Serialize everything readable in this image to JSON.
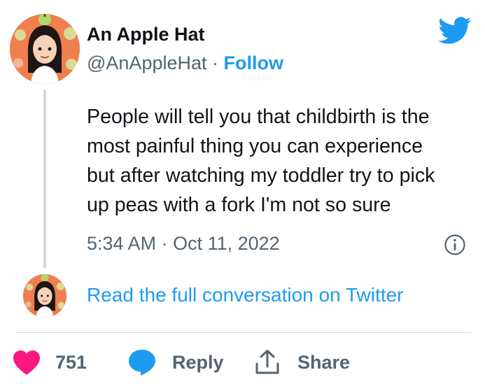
{
  "author": {
    "name": "An Apple Hat",
    "handle": "@AnAppleHat",
    "separator": "·",
    "follow_label": "Follow"
  },
  "tweet": {
    "text_lines": [
      "People will tell you that childbirth is the",
      "most painful thing you can experience",
      "but after watching my toddler try to pick",
      "up peas with a fork I'm not so sure"
    ],
    "time": "5:34 AM",
    "date_separator": "·",
    "date": "Oct 11, 2022"
  },
  "conversation_link": "Read the full conversation on Twitter",
  "actions": {
    "like_count": "751",
    "reply_label": "Reply",
    "share_label": "Share"
  },
  "icons": {
    "brand": "twitter-bird-icon",
    "info": "info-icon",
    "like": "heart-icon",
    "reply": "speech-bubble-icon",
    "share": "share-arrow-icon"
  },
  "colors": {
    "accent": "#1d9bf0",
    "heart": "#f91880",
    "muted_text": "#536471",
    "primary_text": "#0f1419",
    "avatar_bg": "#ef7f4f"
  }
}
